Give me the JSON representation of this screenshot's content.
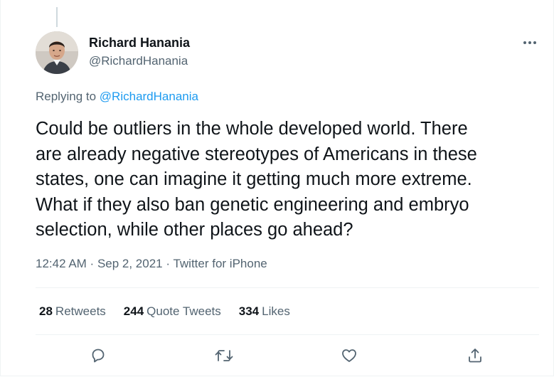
{
  "author": {
    "display_name": "Richard Hanania",
    "handle": "@RichardHanania"
  },
  "reply": {
    "prefix": "Replying to",
    "mention": "@RichardHanania"
  },
  "tweet": {
    "text": "Could be outliers in the whole developed world. There\nare already negative stereotypes of Americans in these\nstates, one can imagine it getting much more extreme.\nWhat if they also ban genetic engineering and embryo\nselection, while other places go ahead?",
    "time": "12:42 AM",
    "separator1": " · ",
    "date": "Sep 2, 2021",
    "separator2": " · ",
    "source": "Twitter for iPhone"
  },
  "stats": {
    "retweets_count": "28",
    "retweets_label": "Retweets",
    "quotes_count": "244",
    "quotes_label": "Quote Tweets",
    "likes_count": "334",
    "likes_label": "Likes"
  },
  "icons": {
    "more": "more-horizontal-icon",
    "reply": "reply-icon",
    "retweet": "retweet-icon",
    "like": "heart-icon",
    "share": "share-icon"
  },
  "colors": {
    "accent": "#1d9bf0",
    "secondary_text": "#536471",
    "primary_text": "#0f1419",
    "divider": "#eff3f4"
  }
}
